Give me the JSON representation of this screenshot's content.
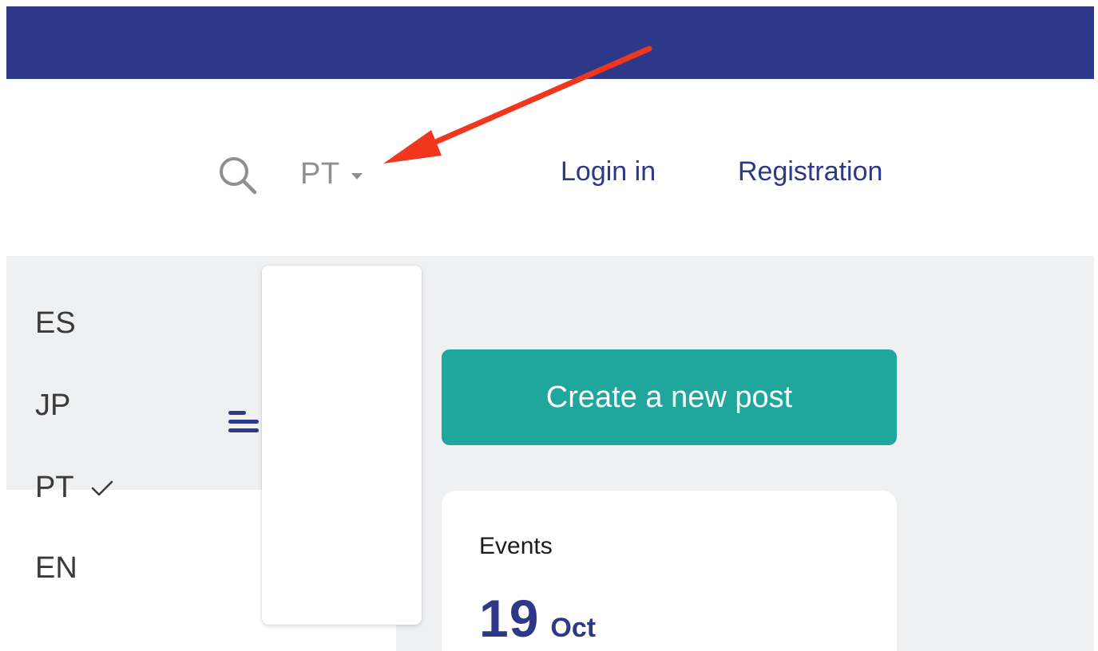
{
  "header": {
    "search_icon": "search-icon",
    "language_selector": {
      "current": "PT",
      "caret_icon": "caret-down-icon"
    },
    "nav": {
      "login_label": "Login in",
      "registration_label": "Registration"
    }
  },
  "language_dropdown": {
    "items": [
      {
        "label": "ES",
        "selected": false
      },
      {
        "label": "JP",
        "selected": false
      },
      {
        "label": "PT",
        "selected": true
      },
      {
        "label": "EN",
        "selected": false
      }
    ],
    "check_icon": "checkmark-icon"
  },
  "sidebar": {
    "menu_icon": "menu-icon"
  },
  "main": {
    "create_post_label": "Create a new post",
    "events": {
      "title": "Events",
      "day": "19",
      "month": "Oct"
    }
  },
  "annotation": {
    "arrow_icon": "annotation-arrow",
    "color": "#f1361e"
  },
  "colors": {
    "brand": "#2e3888",
    "accent": "#1fa79e",
    "content_background": "#eff0f2",
    "muted": "#8f8f8f"
  }
}
